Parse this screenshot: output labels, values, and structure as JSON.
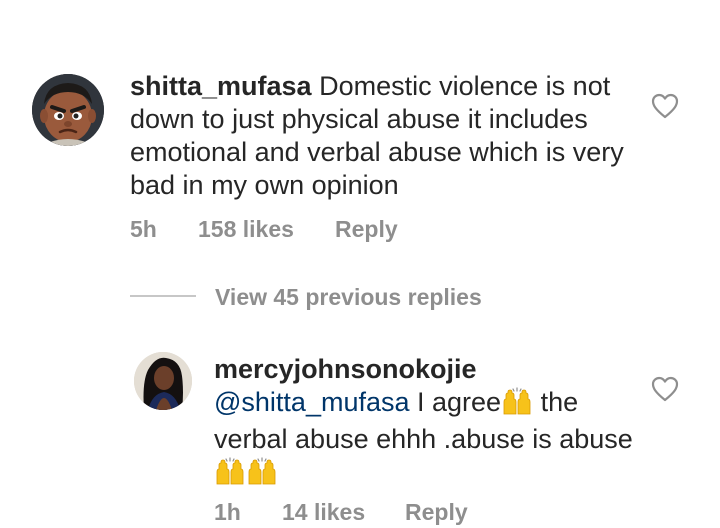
{
  "comments": [
    {
      "username": "shitta_mufasa",
      "text": "Domestic violence is not down to just physical abuse it includes emotional and verbal abuse which is very bad in my own opinion",
      "time": "5h",
      "likes": "158 likes",
      "reply_label": "Reply",
      "avatar_icon": "cartoon-boy-avatar"
    },
    {
      "username": "mercyjohnsonokojie",
      "mention": "@shitta_mufasa",
      "text_part1": " I agree",
      "text_part2": " the verbal abuse ehhh .abuse is abuse",
      "emoji_icon": "raising-hands-emoji",
      "time": "1h",
      "likes": "14 likes",
      "reply_label": "Reply",
      "avatar_icon": "woman-photo-avatar"
    }
  ],
  "view_replies": "View 45 previous replies",
  "colors": {
    "text": "#262626",
    "meta": "#8e8e8e",
    "mention": "#003569",
    "divider": "#c7c7c7"
  }
}
